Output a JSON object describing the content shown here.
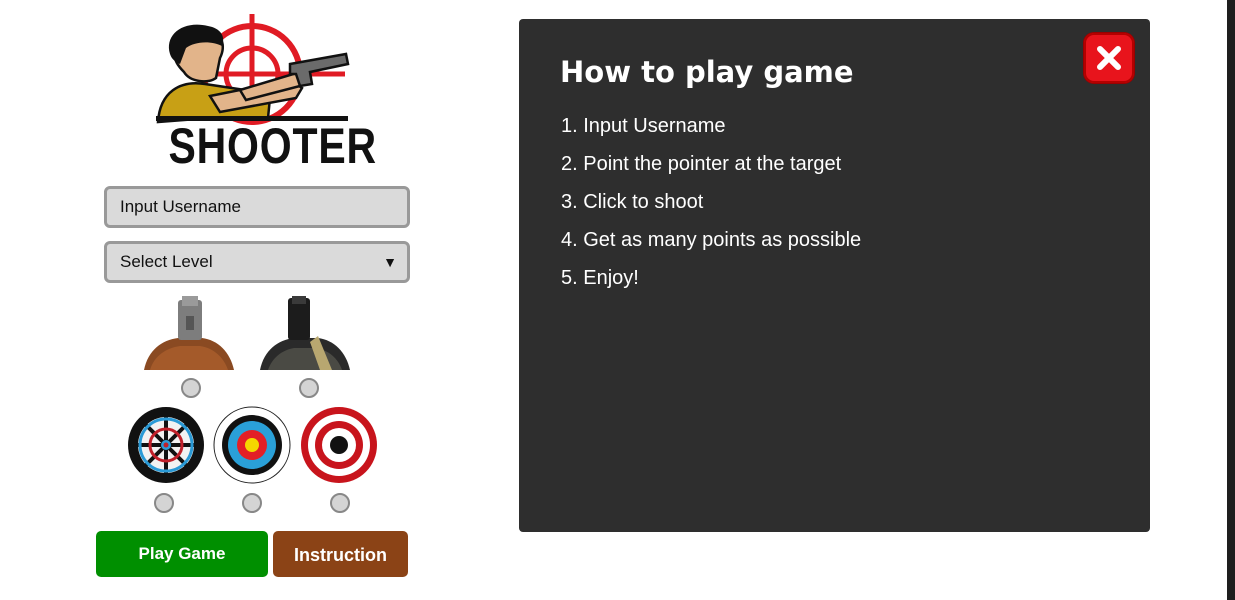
{
  "logo": {
    "text": "SHOOTER"
  },
  "form": {
    "username_placeholder": "Input Username",
    "level_label": "Select Level"
  },
  "weapons": [
    {
      "icon": "pistol-icon"
    },
    {
      "icon": "handgun-icon"
    }
  ],
  "targets": [
    {
      "icon": "dartboard-icon"
    },
    {
      "icon": "archery-target-icon"
    },
    {
      "icon": "bullseye-icon"
    }
  ],
  "buttons": {
    "play": "Play Game",
    "instruction": "Instruction"
  },
  "instructions": {
    "title": "How to play game",
    "steps": [
      "1. Input Username",
      "2. Point the pointer at the target",
      "3. Click to shoot",
      "4. Get as many points as possible",
      "5. Enjoy!"
    ]
  },
  "colors": {
    "play": "#008f00",
    "instruction": "#8b4316",
    "panel": "#2e2e2e",
    "close": "#e8141c"
  }
}
